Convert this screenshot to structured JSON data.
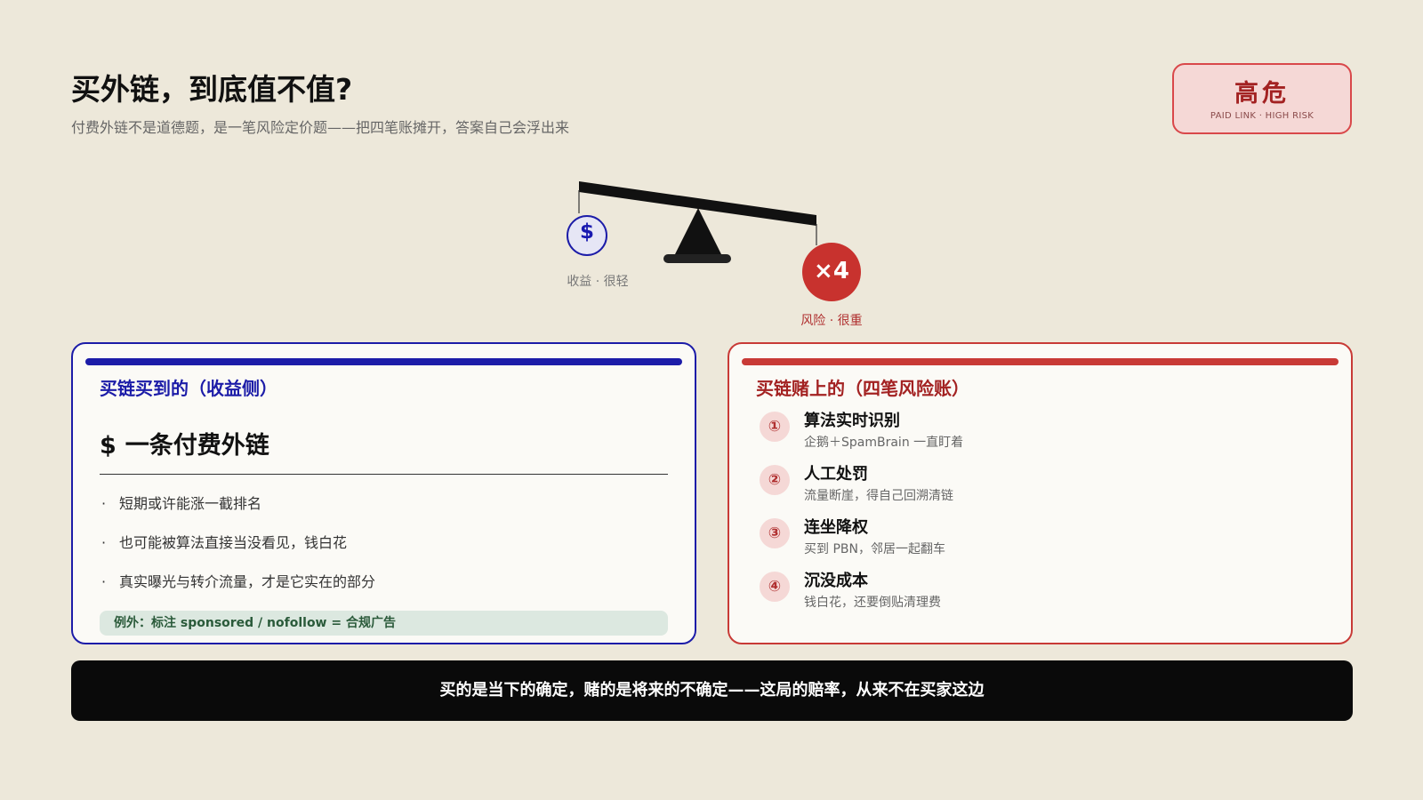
{
  "header": {
    "title": "买外链，到底值不值?",
    "subtitle": "付费外链不是道德题，是一笔风险定价题——把四笔账摊开，答案自己会浮出来"
  },
  "badge": {
    "title": "高危",
    "subtitle": "PAID LINK · HIGH RISK"
  },
  "scale": {
    "light_symbol": "$",
    "light_label": "收益 · 很轻",
    "heavy_symbol": "×4",
    "heavy_label": "风险 · 很重"
  },
  "gain_card": {
    "heading": "买链买到的（收益侧）",
    "item_symbol": "$",
    "item_title": "一条付费外链",
    "bullets": [
      "短期或许能涨一截排名",
      "也可能被算法直接当没看见，钱白花",
      "真实曝光与转介流量，才是它实在的部分"
    ],
    "exception": "例外：标注 sponsored / nofollow = 合规广告"
  },
  "risk_card": {
    "heading": "买链赌上的（四笔风险账）",
    "items": [
      {
        "num": "①",
        "title": "算法实时识别",
        "desc": "企鹅＋SpamBrain 一直盯着"
      },
      {
        "num": "②",
        "title": "人工处罚",
        "desc": "流量断崖，得自己回溯清链"
      },
      {
        "num": "③",
        "title": "连坐降权",
        "desc": "买到 PBN，邻居一起翻车"
      },
      {
        "num": "④",
        "title": "沉没成本",
        "desc": "钱白花，还要倒贴清理费"
      }
    ]
  },
  "footer": {
    "text": "买的是当下的确定，赌的是将来的不确定——这局的赔率，从来不在买家这边"
  },
  "colors": {
    "background": "#ede8da",
    "gain": "#1c1ca8",
    "risk": "#c83a36",
    "footer": "#0a0a0a"
  }
}
